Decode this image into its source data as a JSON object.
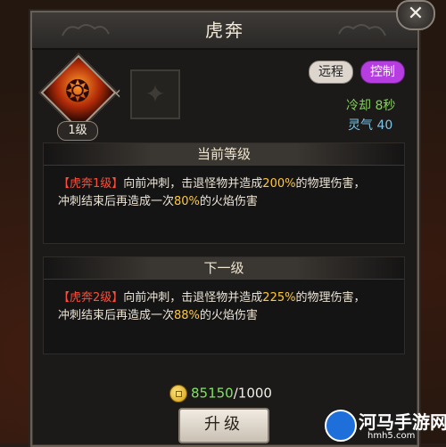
{
  "dialog": {
    "title": "虎奔",
    "close_symbol": "✕"
  },
  "skill": {
    "level_badge": "1级",
    "icon": "tiger-skill-icon",
    "locked_icon": "dark-skill-icon",
    "tags": [
      {
        "label": "远程",
        "color": "#dcd6cf"
      },
      {
        "label": "控制",
        "color": "#b63ee0"
      }
    ],
    "cooldown": "冷却 8秒",
    "spirit": "灵气 40"
  },
  "current_level": {
    "header": "当前等级",
    "name": "【虎奔1级】",
    "line1_a": "向前冲刺，击退怪物并造成",
    "line1_num": "200%",
    "line1_b": "的物理伤害，",
    "line2_a": "冲刺结束后再造成一次",
    "line2_num": "80%",
    "line2_b": "的火焰伤害"
  },
  "next_level": {
    "header": "下一级",
    "name": "【虎奔2级】",
    "line1_a": "向前冲刺，击退怪物并造成",
    "line1_num": "225%",
    "line1_b": "的物理伤害，",
    "line2_a": "冲刺结束后再造成一次",
    "line2_num": "88%",
    "line2_b": "的火焰伤害"
  },
  "cost": {
    "icon": "coin-icon",
    "have": "85150",
    "need": "/1000"
  },
  "upgrade_button": "升级",
  "watermark": {
    "title": "河马手游网",
    "sub": "hmh5.com"
  },
  "colors": {
    "name_red": "#ff4d3a",
    "number_yellow": "#ffc93a",
    "cooldown_green": "#84cf5a",
    "spirit_blue": "#7cc4e8"
  }
}
